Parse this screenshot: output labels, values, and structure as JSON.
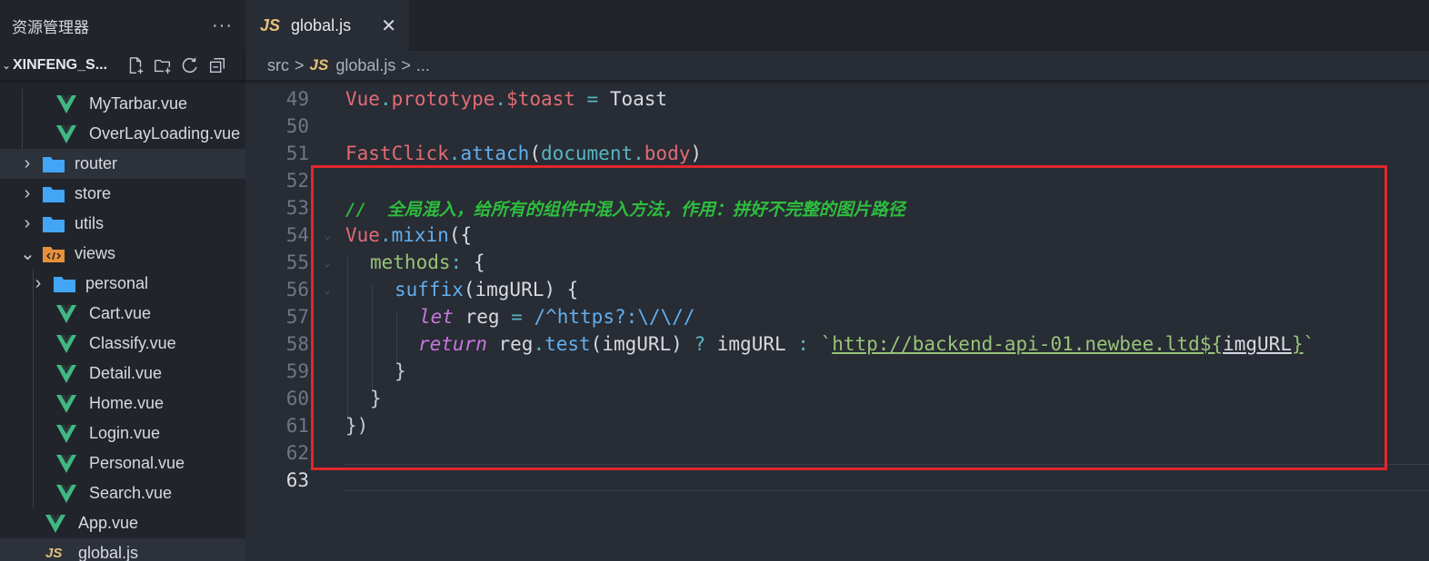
{
  "sidebar": {
    "title": "资源管理器",
    "more": "···",
    "project": {
      "chevron": "⌄",
      "name": "XINFENG_S...",
      "actions": [
        "new-file-icon",
        "new-folder-icon",
        "refresh-icon",
        "collapse-all-icon"
      ]
    },
    "tree": [
      {
        "label": "MyTarbar.vue",
        "type": "vue"
      },
      {
        "label": "OverLayLoading.vue",
        "type": "vue"
      },
      {
        "label": "router",
        "type": "folder"
      },
      {
        "label": "store",
        "type": "folder"
      },
      {
        "label": "utils",
        "type": "folder"
      },
      {
        "label": "views",
        "type": "views-folder"
      },
      {
        "label": "personal",
        "type": "folder"
      },
      {
        "label": "Cart.vue",
        "type": "vue"
      },
      {
        "label": "Classify.vue",
        "type": "vue"
      },
      {
        "label": "Detail.vue",
        "type": "vue"
      },
      {
        "label": "Home.vue",
        "type": "vue"
      },
      {
        "label": "Login.vue",
        "type": "vue"
      },
      {
        "label": "Personal.vue",
        "type": "vue"
      },
      {
        "label": "Search.vue",
        "type": "vue"
      },
      {
        "label": "App.vue",
        "type": "vue"
      },
      {
        "label": "global.js",
        "type": "js",
        "js_badge": "JS"
      }
    ]
  },
  "editor": {
    "tab": {
      "icon": "JS",
      "label": "global.js",
      "close": "✕"
    },
    "breadcrumb": {
      "src": "src",
      "sep": ">",
      "js_icon": "JS",
      "file": "global.js",
      "more": "..."
    },
    "line_numbers": [
      "49",
      "50",
      "51",
      "52",
      "53",
      "54",
      "55",
      "56",
      "57",
      "58",
      "59",
      "60",
      "61",
      "62",
      "63"
    ],
    "code": {
      "l49": {
        "a": "Vue",
        "b": ".",
        "c": "prototype",
        "d": ".",
        "e": "$toast",
        "f": " = ",
        "g": "Toast"
      },
      "l51": {
        "a": "FastClick",
        "b": ".",
        "c": "attach",
        "d": "(",
        "e": "document",
        "f": ".",
        "g": "body",
        "h": ")"
      },
      "l53": {
        "comment": "//  全局混入，给所有的组件中混入方法，作用：拼好不完整的图片路径"
      },
      "l54": {
        "a": "Vue",
        "b": ".",
        "c": "mixin",
        "d": "({"
      },
      "l55": {
        "a": "methods",
        "b": ": ",
        "c": "{"
      },
      "l56": {
        "a": "suffix",
        "b": "(imgURL) {"
      },
      "l57": {
        "a": "let",
        "b": " reg ",
        "c": "=",
        "d": " /^https?:\\/\\//"
      },
      "l58": {
        "a": "return",
        "b": " reg",
        "c": ".",
        "d": "test",
        "e": "(imgURL) ",
        "f": "?",
        "g": " imgURL ",
        "h": ":",
        "i": " `",
        "j": "http://backend-api-01.newbee.ltd${",
        "k": "imgURL",
        "l": "}",
        "m": "`"
      },
      "l59": {
        "a": "}"
      },
      "l60": {
        "a": "}"
      },
      "l61": {
        "a": "})"
      }
    }
  },
  "colors": {
    "highlight_box": "#e0272d",
    "vue_green": "#41b883",
    "folder_blue": "#42a5f5",
    "js_yellow": "#e5c07b"
  }
}
